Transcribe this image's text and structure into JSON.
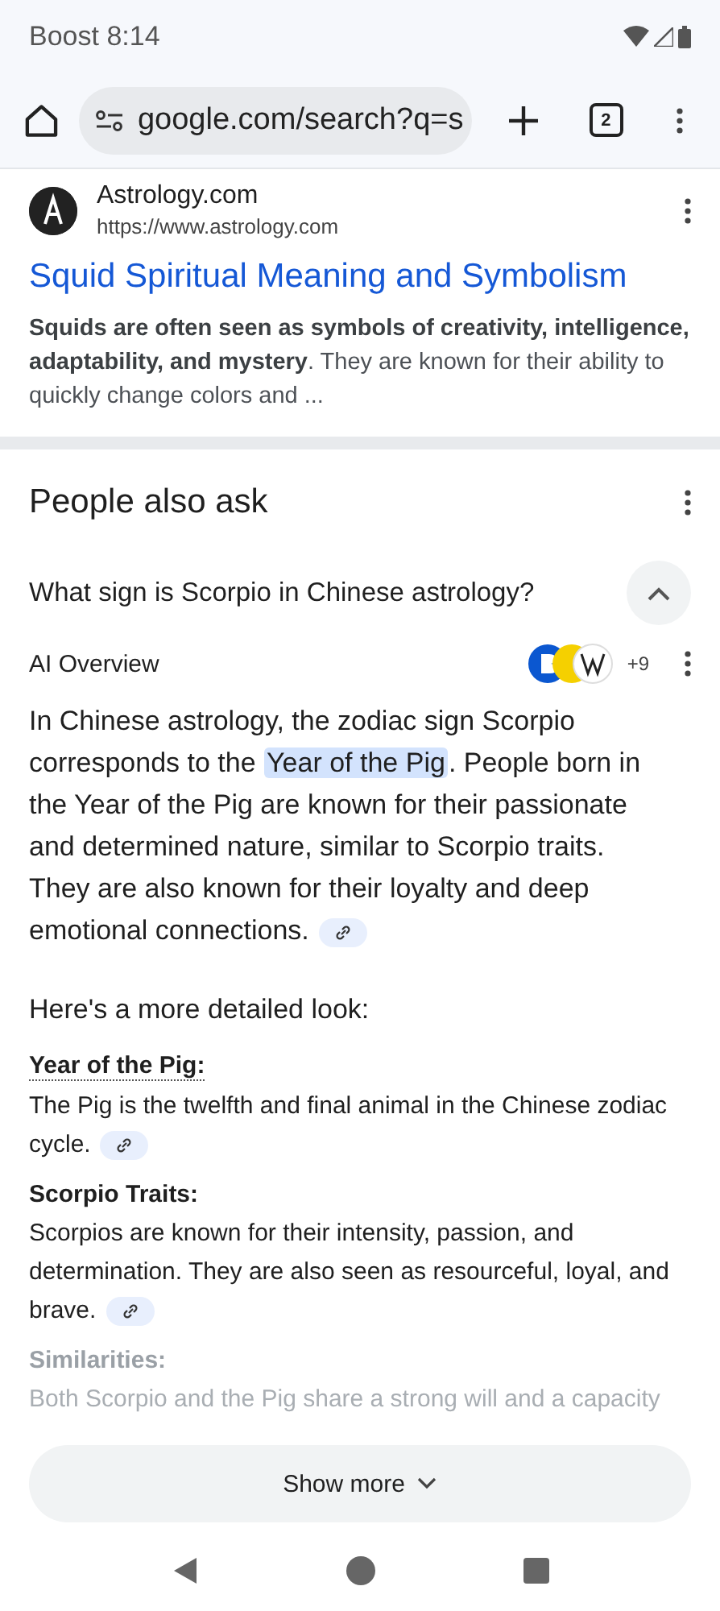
{
  "status_bar": {
    "carrier": "Boost",
    "time": "8:14"
  },
  "toolbar": {
    "url": "google.com/search?q=s",
    "tab_count": "2"
  },
  "result": {
    "site_name": "Astrology.com",
    "site_url": "https://www.astrology.com",
    "title": "Squid Spiritual Meaning and Symbolism",
    "snippet": "**Squids are often seen as symbols of creativity, intelligence, adaptability, and mystery**. They are known for their ability to quickly change colors and ..."
  },
  "people_also_ask": {
    "heading": "People also ask",
    "question": "What sign is Scorpio in Chinese astrology?",
    "expanded": true,
    "ai_overview": {
      "label": "AI Overview",
      "source_count": "+9",
      "intro": [
        {
          "text": "In Chinese astrology, the zodiac sign Scorpio corresponds to the ",
          "highlighted": false
        },
        {
          "text": "Year of the Pig",
          "highlighted": true
        },
        {
          "text": ". People born in the Year of the Pig are known for their passionate and determined nature, similar to Scorpio traits. They are also known for their loyalty and deep emotional connections.",
          "highlighted": false
        }
      ],
      "lead": "Here's a more detailed look:",
      "sections": [
        {
          "heading": "Year of the Pig:",
          "underlined": true,
          "faded": false,
          "body": "The Pig is the twelfth and final animal in the Chinese zodiac cycle.",
          "link": true
        },
        {
          "heading": "Scorpio Traits:",
          "underlined": false,
          "faded": false,
          "body": "Scorpios are known for their intensity, passion, and determination. They are also seen as resourceful, loyal, and brave.",
          "link": true
        },
        {
          "heading": "Similarities:",
          "underlined": false,
          "faded": true,
          "body": "Both Scorpio and the Pig share a strong will and a capacity",
          "link": false
        }
      ]
    },
    "show_more": "Show more"
  }
}
